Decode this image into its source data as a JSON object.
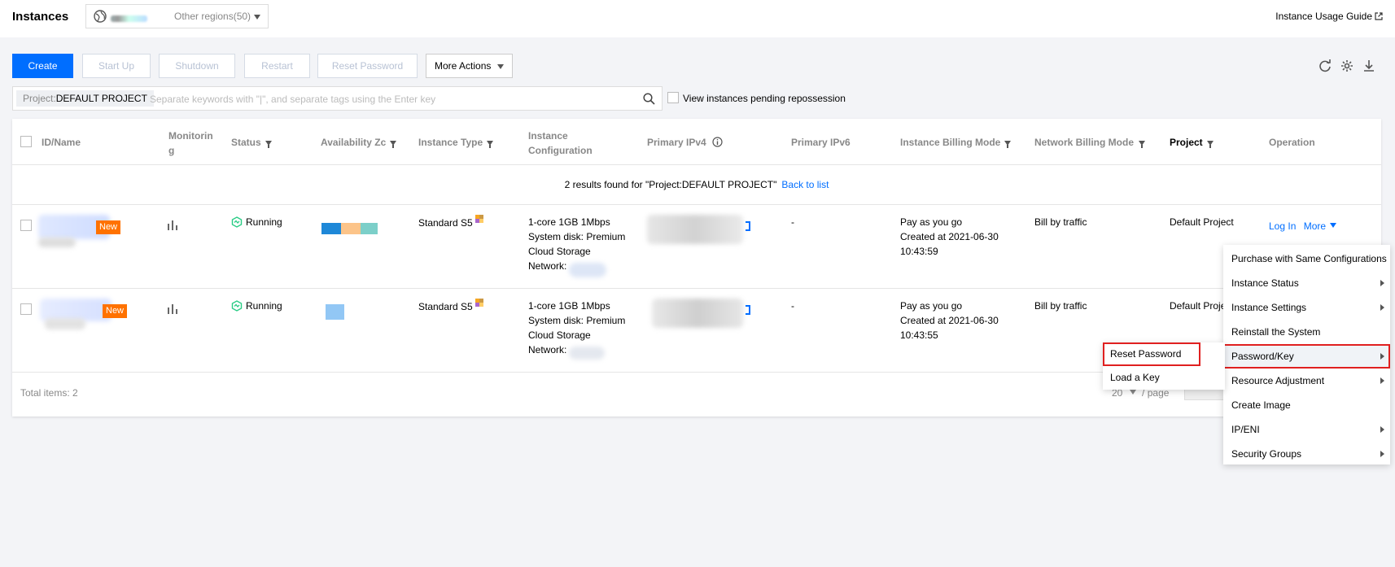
{
  "header": {
    "title": "Instances",
    "region_label": "Other regions(50)",
    "guide_link": "Instance Usage Guide"
  },
  "toolbar": {
    "create": "Create",
    "start_up": "Start Up",
    "shutdown": "Shutdown",
    "restart": "Restart",
    "reset_password": "Reset Password",
    "more_actions": "More Actions"
  },
  "search": {
    "tag_key": "Project:",
    "tag_value": "DEFAULT PROJECT",
    "placeholder": "Separate keywords with \"|\", and separate tags using the Enter key",
    "pending_label": "View instances pending repossession"
  },
  "table": {
    "columns": {
      "id_name": "ID/Name",
      "monitoring": "Monitorin g",
      "status": "Status",
      "availability_zone": "Availability Zc",
      "instance_type": "Instance Type",
      "instance_configuration": "Instance Configuration",
      "primary_ipv4": "Primary IPv4",
      "primary_ipv6": "Primary IPv6",
      "billing_mode": "Instance Billing Mode",
      "network_billing": "Network Billing Mode",
      "project": "Project",
      "operation": "Operation"
    },
    "results_text": "2 results found for \"Project:DEFAULT PROJECT\"",
    "back_to_list": "Back to list",
    "rows": [
      {
        "badge": "New",
        "status": "Running",
        "instance_type": "Standard S5",
        "config_line1": "1-core 1GB 1Mbps",
        "config_line2": "System disk: Premium",
        "config_line3": "Cloud Storage",
        "config_line4": "Network:",
        "ipv6": "-",
        "billing_line1": "Pay as you go",
        "billing_line2": "Created at 2021-06-30",
        "billing_line3": "10:43:59",
        "network_billing": "Bill by traffic",
        "project": "Default Project",
        "op_login": "Log In",
        "op_more": "More"
      },
      {
        "badge": "New",
        "status": "Running",
        "instance_type": "Standard S5",
        "config_line1": "1-core 1GB 1Mbps",
        "config_line2": "System disk: Premium",
        "config_line3": "Cloud Storage",
        "config_line4": "Network:",
        "ipv6": "-",
        "billing_line1": "Pay as you go",
        "billing_line2": "Created at 2021-06-30",
        "billing_line3": "10:43:55",
        "network_billing": "Bill by traffic",
        "project": "Default Proje"
      }
    ],
    "total_items": "Total items: 2",
    "page_size": "20",
    "per_page": "/ page"
  },
  "more_menu": [
    {
      "label": "Purchase with Same Configurations",
      "submenu": false
    },
    {
      "label": "Instance Status",
      "submenu": true
    },
    {
      "label": "Instance Settings",
      "submenu": true
    },
    {
      "label": "Reinstall the System",
      "submenu": false
    },
    {
      "label": "Password/Key",
      "submenu": true
    },
    {
      "label": "Resource Adjustment",
      "submenu": true
    },
    {
      "label": "Create Image",
      "submenu": false
    },
    {
      "label": "IP/ENI",
      "submenu": true
    },
    {
      "label": "Security Groups",
      "submenu": true
    }
  ],
  "password_submenu": [
    {
      "label": "Reset Password"
    },
    {
      "label": "Load a Key"
    }
  ],
  "colors": {
    "primary": "#006eff",
    "badge": "#ff7200",
    "running": "#29cc85",
    "highlight": "#e02020"
  }
}
